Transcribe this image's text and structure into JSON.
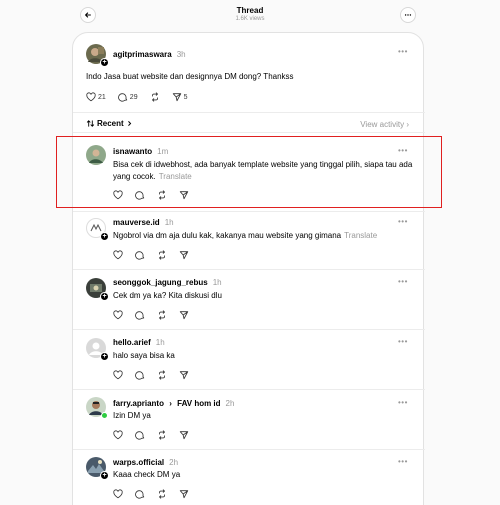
{
  "header": {
    "title": "Thread",
    "views": "1.6K views"
  },
  "post": {
    "username": "agitprimaswara",
    "time": "3h",
    "text": "Indo Jasa buat website dan designnya DM dong? Thankss",
    "likes": "21",
    "replies": "29",
    "reposts": "",
    "shares": "5"
  },
  "sort": {
    "label": "Recent",
    "view_activity": "View activity"
  },
  "replies": [
    {
      "username": "isnawanto",
      "time": "1m",
      "text": "Bisa cek di idwebhost, ada banyak template website yang tinggal pilih, siapa tau ada yang cocok.",
      "translate": "Translate"
    },
    {
      "username": "mauverse.id",
      "time": "1h",
      "text": "Ngobrol via dm aja dulu kak, kakanya mau website yang gimana",
      "translate": "Translate"
    },
    {
      "username": "seonggok_jagung_rebus",
      "time": "1h",
      "text": "Cek dm ya ka? Kita diskusi dlu"
    },
    {
      "username": "hello.arief",
      "time": "1h",
      "text": "halo saya bisa ka"
    },
    {
      "username": "farry.aprianto",
      "arrow": "›",
      "reply_to": "FAV hom id",
      "time": "2h",
      "text": "Izin DM ya"
    },
    {
      "username": "warps.official",
      "time": "2h",
      "text": "Kaaa check DM ya"
    }
  ],
  "icons": {
    "back": "arrow-left-icon",
    "more": "more-horizontal-icon",
    "like": "heart-icon",
    "reply": "comment-icon",
    "repost": "repost-icon",
    "share": "send-icon",
    "sort": "sort-icon",
    "chevron": "chevron-right-icon"
  },
  "colors": {
    "highlight": "#e02020",
    "online": "#2ecc40"
  }
}
